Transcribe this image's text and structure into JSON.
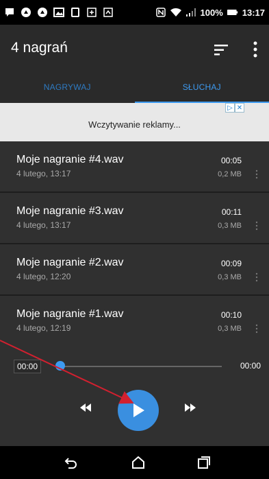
{
  "status_bar": {
    "battery": "100%",
    "time": "13:17"
  },
  "app_bar": {
    "title": "4 nagrań",
    "sort_icon": "sort-icon",
    "more_icon": "more-vert-icon"
  },
  "tabs": [
    {
      "label": "NAGRYWAJ",
      "active": false
    },
    {
      "label": "SŁUCHAJ",
      "active": true
    }
  ],
  "ad": {
    "text": "Wczytywanie reklamy..."
  },
  "recordings": [
    {
      "name": "Moje nagranie #4.wav",
      "date": "4 lutego, 13:17",
      "duration": "00:05",
      "size": "0,2 MB"
    },
    {
      "name": "Moje nagranie #3.wav",
      "date": "4 lutego, 13:17",
      "duration": "00:11",
      "size": "0,3 MB"
    },
    {
      "name": "Moje nagranie #2.wav",
      "date": "4 lutego, 12:20",
      "duration": "00:09",
      "size": "0,3 MB"
    },
    {
      "name": "Moje nagranie #1.wav",
      "date": "4 lutego, 12:19",
      "duration": "00:10",
      "size": "0,3 MB"
    }
  ],
  "player": {
    "position": "00:00",
    "duration": "00:00",
    "progress": 0
  },
  "colors": {
    "accent": "#3d9af0",
    "annotation": "#d2202f"
  }
}
